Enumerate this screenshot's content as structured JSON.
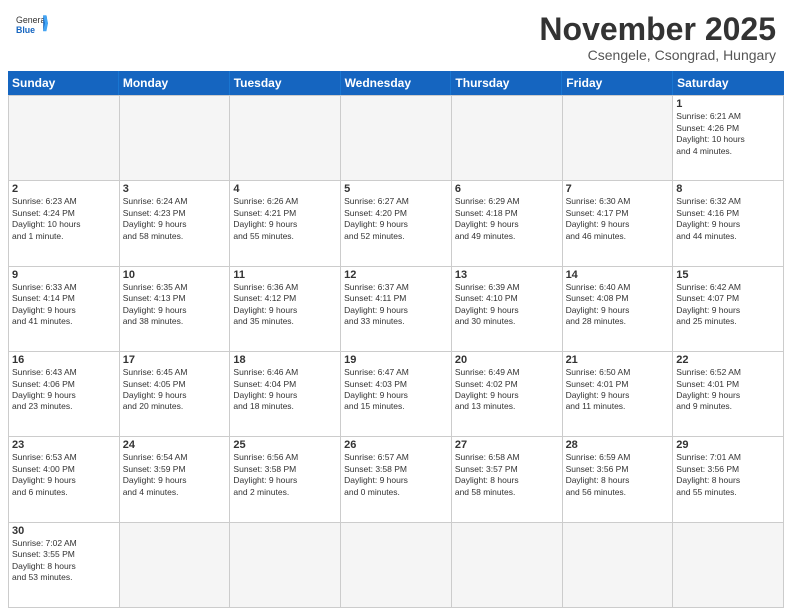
{
  "header": {
    "logo_general": "General",
    "logo_blue": "Blue",
    "main_title": "November 2025",
    "subtitle": "Csengele, Csongrad, Hungary"
  },
  "day_headers": [
    "Sunday",
    "Monday",
    "Tuesday",
    "Wednesday",
    "Thursday",
    "Friday",
    "Saturday"
  ],
  "days": [
    {
      "num": "",
      "info": "",
      "empty": true
    },
    {
      "num": "",
      "info": "",
      "empty": true
    },
    {
      "num": "",
      "info": "",
      "empty": true
    },
    {
      "num": "",
      "info": "",
      "empty": true
    },
    {
      "num": "",
      "info": "",
      "empty": true
    },
    {
      "num": "",
      "info": "",
      "empty": true
    },
    {
      "num": "1",
      "info": "Sunrise: 6:21 AM\nSunset: 4:26 PM\nDaylight: 10 hours\nand 4 minutes."
    },
    {
      "num": "2",
      "info": "Sunrise: 6:23 AM\nSunset: 4:24 PM\nDaylight: 10 hours\nand 1 minute."
    },
    {
      "num": "3",
      "info": "Sunrise: 6:24 AM\nSunset: 4:23 PM\nDaylight: 9 hours\nand 58 minutes."
    },
    {
      "num": "4",
      "info": "Sunrise: 6:26 AM\nSunset: 4:21 PM\nDaylight: 9 hours\nand 55 minutes."
    },
    {
      "num": "5",
      "info": "Sunrise: 6:27 AM\nSunset: 4:20 PM\nDaylight: 9 hours\nand 52 minutes."
    },
    {
      "num": "6",
      "info": "Sunrise: 6:29 AM\nSunset: 4:18 PM\nDaylight: 9 hours\nand 49 minutes."
    },
    {
      "num": "7",
      "info": "Sunrise: 6:30 AM\nSunset: 4:17 PM\nDaylight: 9 hours\nand 46 minutes."
    },
    {
      "num": "8",
      "info": "Sunrise: 6:32 AM\nSunset: 4:16 PM\nDaylight: 9 hours\nand 44 minutes."
    },
    {
      "num": "9",
      "info": "Sunrise: 6:33 AM\nSunset: 4:14 PM\nDaylight: 9 hours\nand 41 minutes."
    },
    {
      "num": "10",
      "info": "Sunrise: 6:35 AM\nSunset: 4:13 PM\nDaylight: 9 hours\nand 38 minutes."
    },
    {
      "num": "11",
      "info": "Sunrise: 6:36 AM\nSunset: 4:12 PM\nDaylight: 9 hours\nand 35 minutes."
    },
    {
      "num": "12",
      "info": "Sunrise: 6:37 AM\nSunset: 4:11 PM\nDaylight: 9 hours\nand 33 minutes."
    },
    {
      "num": "13",
      "info": "Sunrise: 6:39 AM\nSunset: 4:10 PM\nDaylight: 9 hours\nand 30 minutes."
    },
    {
      "num": "14",
      "info": "Sunrise: 6:40 AM\nSunset: 4:08 PM\nDaylight: 9 hours\nand 28 minutes."
    },
    {
      "num": "15",
      "info": "Sunrise: 6:42 AM\nSunset: 4:07 PM\nDaylight: 9 hours\nand 25 minutes."
    },
    {
      "num": "16",
      "info": "Sunrise: 6:43 AM\nSunset: 4:06 PM\nDaylight: 9 hours\nand 23 minutes."
    },
    {
      "num": "17",
      "info": "Sunrise: 6:45 AM\nSunset: 4:05 PM\nDaylight: 9 hours\nand 20 minutes."
    },
    {
      "num": "18",
      "info": "Sunrise: 6:46 AM\nSunset: 4:04 PM\nDaylight: 9 hours\nand 18 minutes."
    },
    {
      "num": "19",
      "info": "Sunrise: 6:47 AM\nSunset: 4:03 PM\nDaylight: 9 hours\nand 15 minutes."
    },
    {
      "num": "20",
      "info": "Sunrise: 6:49 AM\nSunset: 4:02 PM\nDaylight: 9 hours\nand 13 minutes."
    },
    {
      "num": "21",
      "info": "Sunrise: 6:50 AM\nSunset: 4:01 PM\nDaylight: 9 hours\nand 11 minutes."
    },
    {
      "num": "22",
      "info": "Sunrise: 6:52 AM\nSunset: 4:01 PM\nDaylight: 9 hours\nand 9 minutes."
    },
    {
      "num": "23",
      "info": "Sunrise: 6:53 AM\nSunset: 4:00 PM\nDaylight: 9 hours\nand 6 minutes."
    },
    {
      "num": "24",
      "info": "Sunrise: 6:54 AM\nSunset: 3:59 PM\nDaylight: 9 hours\nand 4 minutes."
    },
    {
      "num": "25",
      "info": "Sunrise: 6:56 AM\nSunset: 3:58 PM\nDaylight: 9 hours\nand 2 minutes."
    },
    {
      "num": "26",
      "info": "Sunrise: 6:57 AM\nSunset: 3:58 PM\nDaylight: 9 hours\nand 0 minutes."
    },
    {
      "num": "27",
      "info": "Sunrise: 6:58 AM\nSunset: 3:57 PM\nDaylight: 8 hours\nand 58 minutes."
    },
    {
      "num": "28",
      "info": "Sunrise: 6:59 AM\nSunset: 3:56 PM\nDaylight: 8 hours\nand 56 minutes."
    },
    {
      "num": "29",
      "info": "Sunrise: 7:01 AM\nSunset: 3:56 PM\nDaylight: 8 hours\nand 55 minutes."
    },
    {
      "num": "30",
      "info": "Sunrise: 7:02 AM\nSunset: 3:55 PM\nDaylight: 8 hours\nand 53 minutes."
    },
    {
      "num": "",
      "info": "",
      "empty": true
    },
    {
      "num": "",
      "info": "",
      "empty": true
    },
    {
      "num": "",
      "info": "",
      "empty": true
    },
    {
      "num": "",
      "info": "",
      "empty": true
    },
    {
      "num": "",
      "info": "",
      "empty": true
    },
    {
      "num": "",
      "info": "",
      "empty": true
    }
  ]
}
